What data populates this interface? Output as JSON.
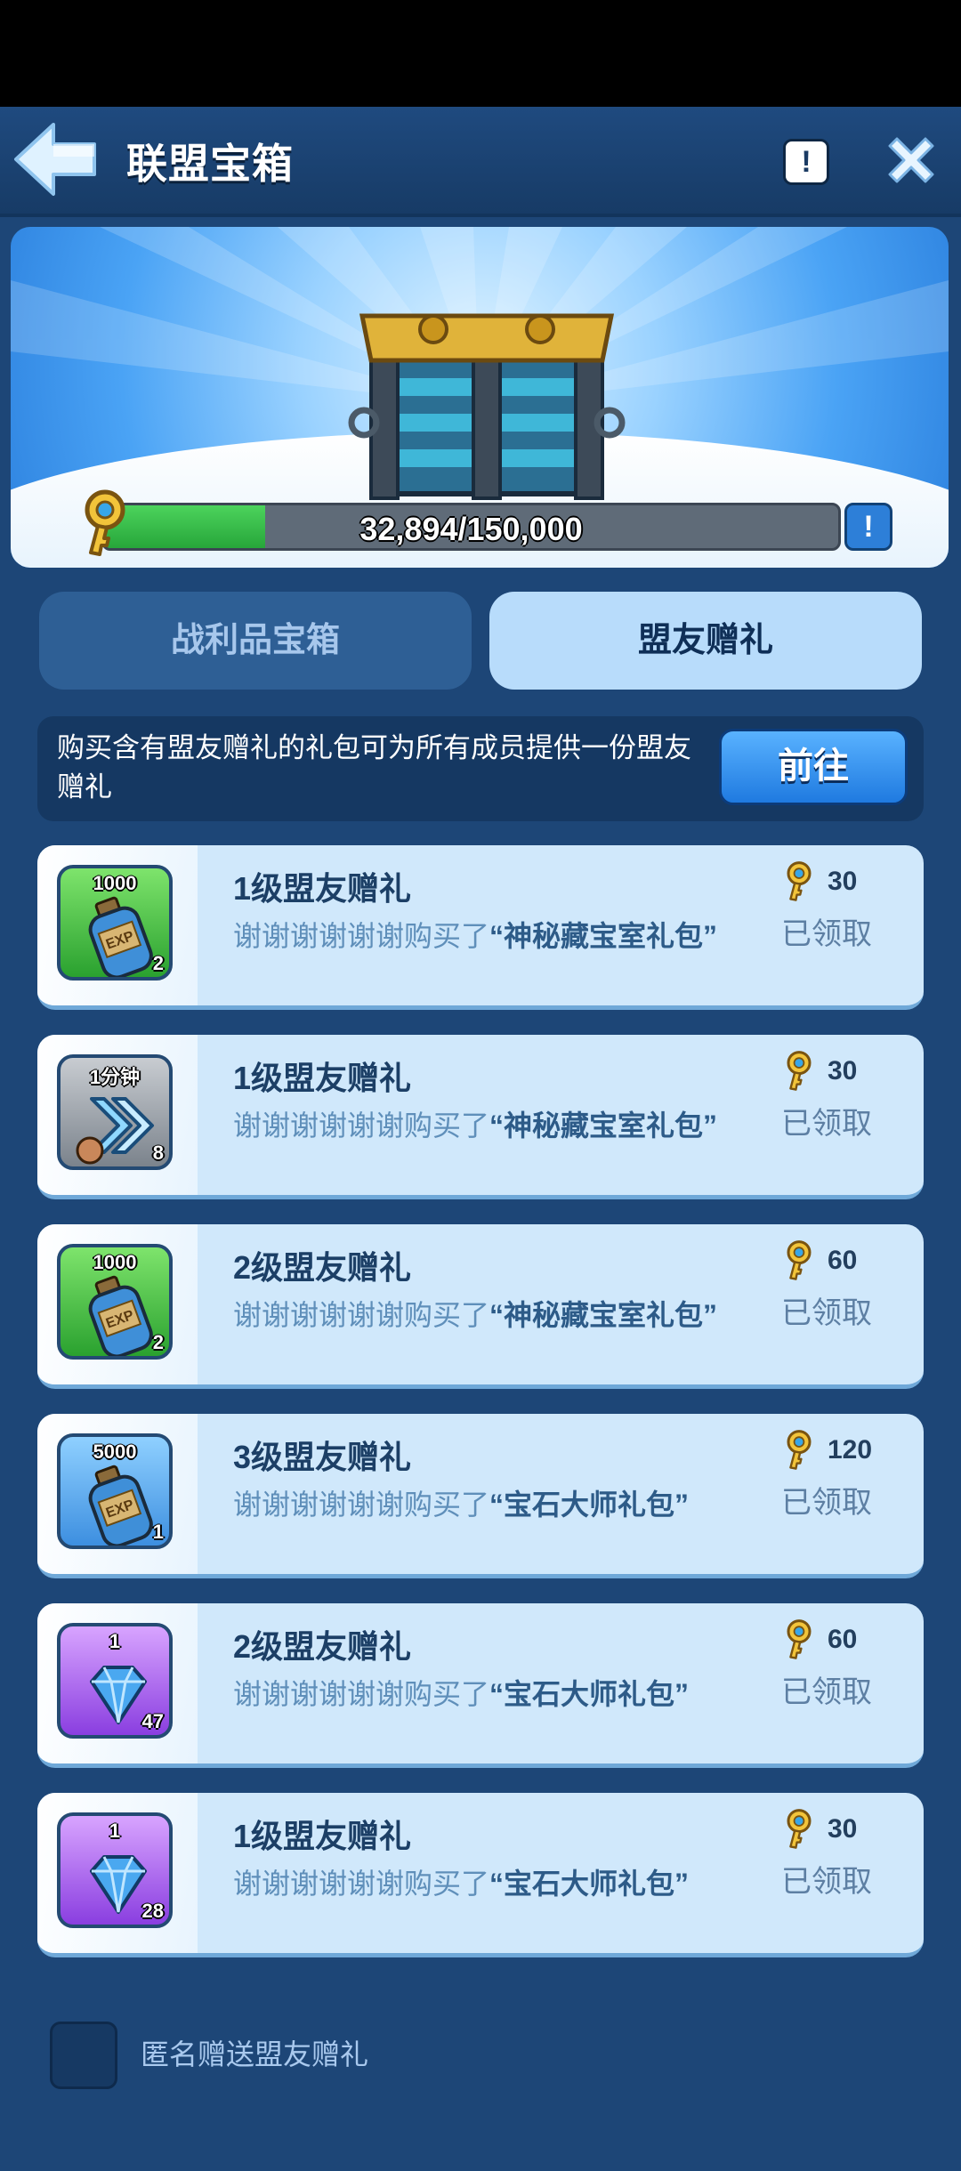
{
  "header": {
    "title": "联盟宝箱",
    "info_glyph": "!"
  },
  "hero": {
    "progress_text": "32,894/150,000",
    "progress_fraction": 0.219,
    "info_glyph": "!"
  },
  "tabs": [
    {
      "label": "战利品宝箱",
      "active": false
    },
    {
      "label": "盟友赠礼",
      "active": true
    }
  ],
  "promo": {
    "text": "购买含有盟友赠礼的礼包可为所有成员提供一份盟友赠礼",
    "button_label": "前往"
  },
  "gifts": [
    {
      "icon": "exp-potion-icon",
      "theme": "green",
      "top_label": "1000",
      "count": "2",
      "title": "1级盟友赠礼",
      "desc_prefix": "谢谢谢谢谢谢购买了",
      "desc_pack": "“神秘藏宝室礼包”",
      "keys": "30",
      "status": "已领取"
    },
    {
      "icon": "speedup-icon",
      "theme": "grey",
      "top_label": "1分钟",
      "count": "8",
      "title": "1级盟友赠礼",
      "desc_prefix": "谢谢谢谢谢谢购买了",
      "desc_pack": "“神秘藏宝室礼包”",
      "keys": "30",
      "status": "已领取"
    },
    {
      "icon": "exp-potion-icon",
      "theme": "green",
      "top_label": "1000",
      "count": "2",
      "title": "2级盟友赠礼",
      "desc_prefix": "谢谢谢谢谢谢购买了",
      "desc_pack": "“神秘藏宝室礼包”",
      "keys": "60",
      "status": "已领取"
    },
    {
      "icon": "exp-potion-icon",
      "theme": "blue",
      "top_label": "5000",
      "count": "1",
      "title": "3级盟友赠礼",
      "desc_prefix": "谢谢谢谢谢谢购买了",
      "desc_pack": "“宝石大师礼包”",
      "keys": "120",
      "status": "已领取"
    },
    {
      "icon": "gem-icon",
      "theme": "purple",
      "top_label": "1",
      "count": "47",
      "title": "2级盟友赠礼",
      "desc_prefix": "谢谢谢谢谢谢购买了",
      "desc_pack": "“宝石大师礼包”",
      "keys": "60",
      "status": "已领取"
    },
    {
      "icon": "gem-icon",
      "theme": "purple",
      "top_label": "1",
      "count": "28",
      "title": "1级盟友赠礼",
      "desc_prefix": "谢谢谢谢谢谢购买了",
      "desc_pack": "“宝石大师礼包”",
      "keys": "30",
      "status": "已领取"
    }
  ],
  "footer": {
    "anon_label": "匿名赠送盟友赠礼",
    "anon_checked": false
  },
  "colors": {
    "background": "#1d4677",
    "progress": "#2fb544",
    "tab_active": "#b8dcfb",
    "button": "#2f8ff0"
  }
}
